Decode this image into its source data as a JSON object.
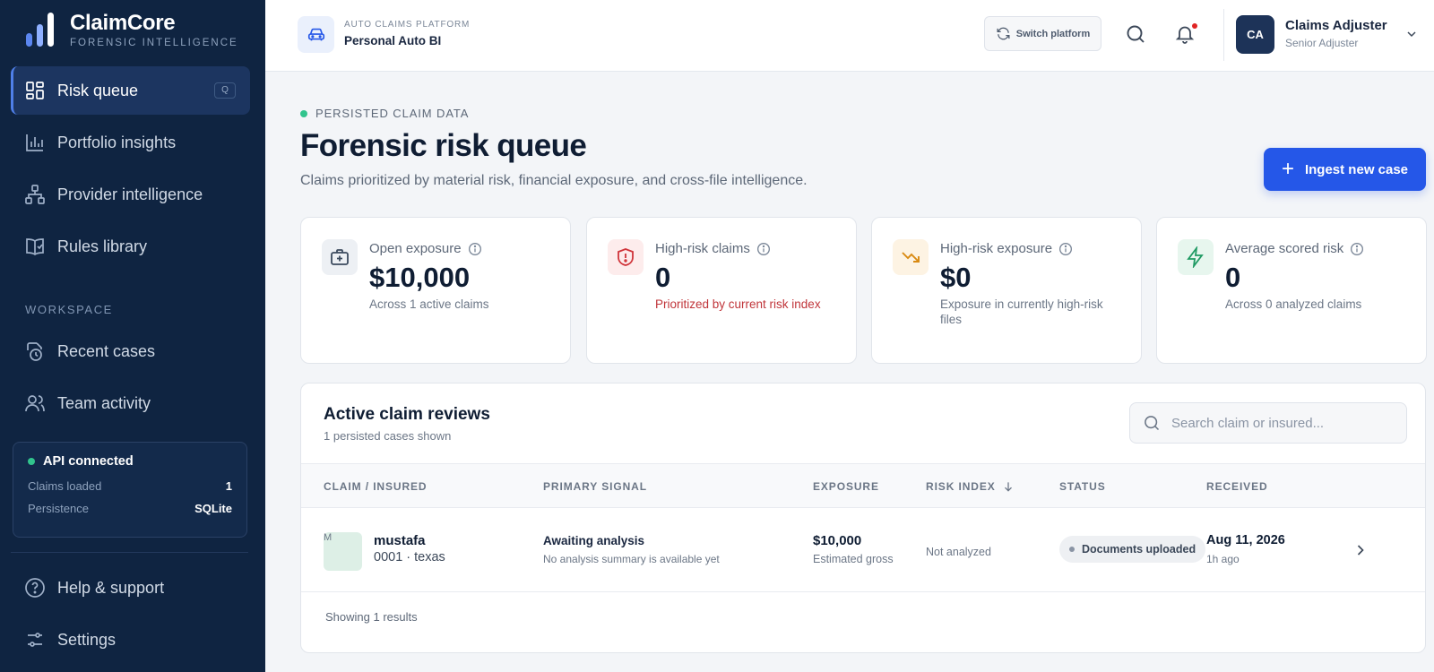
{
  "brand": {
    "name": "ClaimCore",
    "subtitle": "FORENSIC INTELLIGENCE"
  },
  "sidebar": {
    "nav": [
      {
        "label": "Risk queue",
        "icon": "grid-icon",
        "shortcut": "Q",
        "active": true
      },
      {
        "label": "Portfolio insights",
        "icon": "bar-chart-icon"
      },
      {
        "label": "Provider intelligence",
        "icon": "network-icon"
      },
      {
        "label": "Rules library",
        "icon": "book-check-icon"
      }
    ],
    "workspace_label": "WORKSPACE",
    "workspace": [
      {
        "label": "Recent cases",
        "icon": "clock-document-icon"
      },
      {
        "label": "Team activity",
        "icon": "users-icon"
      }
    ],
    "api": {
      "title": "API connected",
      "claims_loaded_label": "Claims loaded",
      "claims_loaded_value": "1",
      "persistence_label": "Persistence",
      "persistence_value": "SQLite"
    },
    "bottom": [
      {
        "label": "Help & support",
        "icon": "help-circle-icon"
      },
      {
        "label": "Settings",
        "icon": "sliders-icon"
      }
    ]
  },
  "header": {
    "platform_eyebrow": "AUTO CLAIMS PLATFORM",
    "platform_name": "Personal Auto BI",
    "switch_label": "Switch platform",
    "user_initials": "CA",
    "user_name": "Claims Adjuster",
    "user_role": "Senior Adjuster"
  },
  "page": {
    "eyebrow": "PERSISTED CLAIM DATA",
    "title": "Forensic risk queue",
    "subtitle": "Claims prioritized by material risk, financial exposure, and cross-file intelligence.",
    "ingest_label": "Ingest new case"
  },
  "kpis": [
    {
      "label": "Open exposure",
      "value": "$10,000",
      "note": "Across 1 active claims",
      "icon": "medical-case-icon",
      "accent": "#3b4a5e"
    },
    {
      "label": "High-risk claims",
      "value": "0",
      "note": "Prioritized by current risk index",
      "icon": "shield-alert-icon",
      "accent": "#d0343a"
    },
    {
      "label": "High-risk exposure",
      "value": "$0",
      "note": "Exposure in currently high-risk files",
      "icon": "trend-down-icon",
      "accent": "#d98a12"
    },
    {
      "label": "Average scored risk",
      "value": "0",
      "note": "Across 0 analyzed claims",
      "icon": "bolt-icon",
      "accent": "#1f9a63"
    }
  ],
  "table": {
    "title": "Active claim reviews",
    "subtitle": "1 persisted cases shown",
    "search_placeholder": "Search claim or insured...",
    "columns": [
      "CLAIM / INSURED",
      "PRIMARY SIGNAL",
      "EXPOSURE",
      "RISK INDEX",
      "STATUS",
      "RECEIVED"
    ],
    "rows": [
      {
        "thumb": "M",
        "name": "mustafa",
        "id_line": "0001 · texas",
        "signal": "Awaiting analysis",
        "signal_sub": "No analysis summary is available yet",
        "exposure": "$10,000",
        "exposure_sub": "Estimated gross",
        "risk": "Not analyzed",
        "status": "Documents uploaded",
        "received": "Aug 11, 2026",
        "ago": "1h ago"
      }
    ],
    "footer": "Showing 1 results"
  },
  "colors": {
    "sidebar_bg": "#0f2441",
    "primary": "#2557e8",
    "connected": "#31c48d"
  }
}
